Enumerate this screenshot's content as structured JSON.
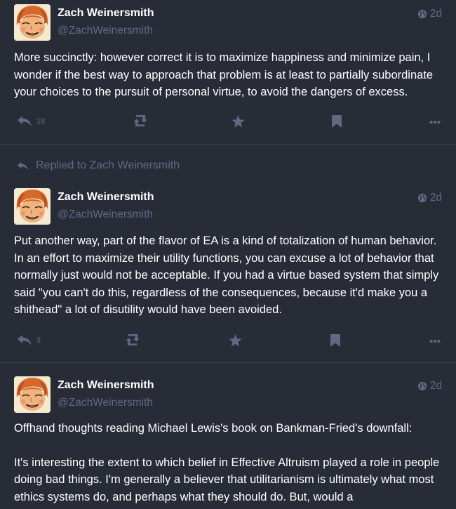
{
  "colors": {
    "background": "#282c37",
    "divider": "#393f4f",
    "muted": "#606984",
    "text": "#ffffff"
  },
  "posts": [
    {
      "author_name": "Zach Weinersmith",
      "handle": "@ZachWeinersmith",
      "time": "2d",
      "paragraphs": [
        "More succinctly: however correct it is to maximize happiness and minimize pain, I wonder if the best way to approach that problem is at least to partially subordinate your choices to the pursuit of personal virtue, to avoid the dangers of excess."
      ],
      "reply_count": "18"
    },
    {
      "replied_label": "Replied to Zach Weinersmith",
      "author_name": "Zach Weinersmith",
      "handle": "@ZachWeinersmith",
      "time": "2d",
      "paragraphs": [
        "Put another way, part of the flavor of EA is a kind of totalization of human behavior. In an effort to maximize their utility functions, you can excuse a lot of behavior that normally just would not be acceptable. If you had a virtue based system that simply said \"you can't do this, regardless of the consequences, because it'd make you a shithead\" a lot of disutility would have been avoided."
      ],
      "reply_count": "3"
    },
    {
      "author_name": "Zach Weinersmith",
      "handle": "@ZachWeinersmith",
      "time": "2d",
      "paragraphs": [
        "Offhand thoughts reading Michael Lewis's book on Bankman-Fried's downfall:",
        "It's interesting the extent to which belief in Effective Altruism played a role in people doing bad things. I'm generally a believer that utilitarianism is ultimately what most ethics systems do, and perhaps what they should do. But, would a"
      ]
    }
  ],
  "icons": {
    "reply": "reply-icon",
    "boost": "boost-icon",
    "favourite": "star-icon",
    "bookmark": "bookmark-icon",
    "more": "ellipsis-icon",
    "visibility": "globe-icon"
  }
}
